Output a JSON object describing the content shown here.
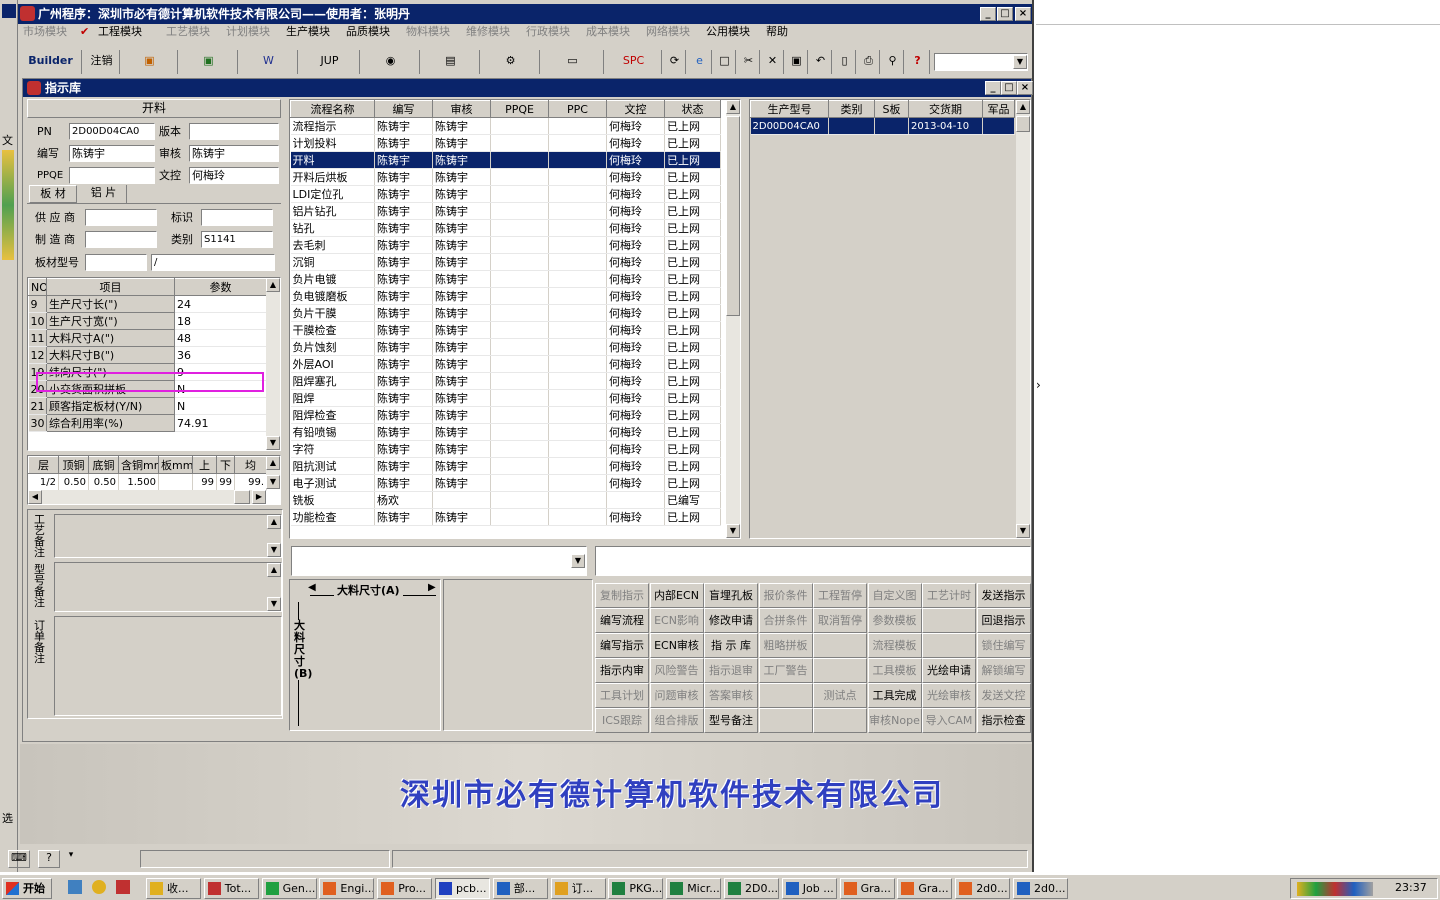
{
  "window_title": "广州程序：深圳市必有德计算机软件技术有限公司——使用者：张明丹",
  "menu": {
    "items": [
      "市场模块",
      "工程模块",
      "工艺模块",
      "计划模块",
      "生产模块",
      "品质模块",
      "物料模块",
      "维修模块",
      "行政模块",
      "成本模块",
      "网络模块",
      "公用模块",
      "帮助"
    ]
  },
  "toolbar": {
    "builder": "Builder",
    "logout": "注销",
    "jup": "JUP",
    "spc": "SPC"
  },
  "child_title": "指示库",
  "left": {
    "section_title": "开料",
    "pn_label": "PN",
    "pn_value": "2D00D04CA0",
    "version_label": "版本",
    "version_value": "",
    "editor_label": "编写",
    "editor_value": "陈铸宇",
    "reviewer_label": "审核",
    "reviewer_value": "陈铸宇",
    "ppqe_label": "PPQE",
    "ppqe_value": "",
    "doc_label": "文控",
    "doc_value": "何梅玲",
    "tab1": "板 材",
    "tab2": "铝 片",
    "supplier_label": "供 应 商",
    "mark_label": "标识",
    "maker_label": "制 造 商",
    "category_label": "类别",
    "category_value": "S1141",
    "board_label": "板材型号",
    "board_value2": "/",
    "params_headers": [
      "NO",
      "项目",
      "参数"
    ],
    "params": [
      {
        "no": "9",
        "item": "生产尺寸长(\")",
        "val": "24"
      },
      {
        "no": "10",
        "item": "生产尺寸宽(\")",
        "val": "18"
      },
      {
        "no": "11",
        "item": "大料尺寸A(\")",
        "val": "48"
      },
      {
        "no": "12",
        "item": "大料尺寸B(\")",
        "val": "36"
      },
      {
        "no": "19",
        "item": "纬向尺寸(\")",
        "val": "9"
      },
      {
        "no": "20",
        "item": "小交货面积拼板",
        "val": "N"
      },
      {
        "no": "21",
        "item": "顾客指定板材(Y/N)",
        "val": "N"
      },
      {
        "no": "30",
        "item": "综合利用率(%)",
        "val": "74.91"
      }
    ],
    "layer_headers": [
      "层",
      "顶铜",
      "底铜",
      "含铜mm",
      "板mm",
      "上",
      "下",
      "均"
    ],
    "layer_row": [
      "1/2",
      "0.50",
      "0.50",
      "1.500",
      "",
      "99",
      "99",
      "99."
    ],
    "note1_label": "工艺备注",
    "note2_label": "型号备注",
    "note3_label": "订单备注"
  },
  "process": {
    "headers": [
      "流程名称",
      "编写",
      "审核",
      "PPQE",
      "PPC",
      "文控",
      "状态"
    ],
    "rows": [
      [
        "流程指示",
        "陈铸宇",
        "陈铸宇",
        "",
        "",
        "何梅玲",
        "已上网"
      ],
      [
        "计划投料",
        "陈铸宇",
        "陈铸宇",
        "",
        "",
        "何梅玲",
        "已上网"
      ],
      [
        "开料",
        "陈铸宇",
        "陈铸宇",
        "",
        "",
        "何梅玲",
        "已上网"
      ],
      [
        "开料后烘板",
        "陈铸宇",
        "陈铸宇",
        "",
        "",
        "何梅玲",
        "已上网"
      ],
      [
        "LDI定位孔",
        "陈铸宇",
        "陈铸宇",
        "",
        "",
        "何梅玲",
        "已上网"
      ],
      [
        "铝片钻孔",
        "陈铸宇",
        "陈铸宇",
        "",
        "",
        "何梅玲",
        "已上网"
      ],
      [
        "钻孔",
        "陈铸宇",
        "陈铸宇",
        "",
        "",
        "何梅玲",
        "已上网"
      ],
      [
        "去毛刺",
        "陈铸宇",
        "陈铸宇",
        "",
        "",
        "何梅玲",
        "已上网"
      ],
      [
        "沉铜",
        "陈铸宇",
        "陈铸宇",
        "",
        "",
        "何梅玲",
        "已上网"
      ],
      [
        "负片电镀",
        "陈铸宇",
        "陈铸宇",
        "",
        "",
        "何梅玲",
        "已上网"
      ],
      [
        "负电镀磨板",
        "陈铸宇",
        "陈铸宇",
        "",
        "",
        "何梅玲",
        "已上网"
      ],
      [
        "负片干膜",
        "陈铸宇",
        "陈铸宇",
        "",
        "",
        "何梅玲",
        "已上网"
      ],
      [
        "干膜检查",
        "陈铸宇",
        "陈铸宇",
        "",
        "",
        "何梅玲",
        "已上网"
      ],
      [
        "负片蚀刻",
        "陈铸宇",
        "陈铸宇",
        "",
        "",
        "何梅玲",
        "已上网"
      ],
      [
        "外层AOI",
        "陈铸宇",
        "陈铸宇",
        "",
        "",
        "何梅玲",
        "已上网"
      ],
      [
        "阻焊塞孔",
        "陈铸宇",
        "陈铸宇",
        "",
        "",
        "何梅玲",
        "已上网"
      ],
      [
        "阻焊",
        "陈铸宇",
        "陈铸宇",
        "",
        "",
        "何梅玲",
        "已上网"
      ],
      [
        "阻焊检查",
        "陈铸宇",
        "陈铸宇",
        "",
        "",
        "何梅玲",
        "已上网"
      ],
      [
        "有铅喷锡",
        "陈铸宇",
        "陈铸宇",
        "",
        "",
        "何梅玲",
        "已上网"
      ],
      [
        "字符",
        "陈铸宇",
        "陈铸宇",
        "",
        "",
        "何梅玲",
        "已上网"
      ],
      [
        "阻抗测试",
        "陈铸宇",
        "陈铸宇",
        "",
        "",
        "何梅玲",
        "已上网"
      ],
      [
        "电子测试",
        "陈铸宇",
        "陈铸宇",
        "",
        "",
        "何梅玲",
        "已上网"
      ],
      [
        "铣板",
        "杨欢",
        "",
        "",
        "",
        "",
        "已编写"
      ],
      [
        "功能检查",
        "陈铸宇",
        "陈铸宇",
        "",
        "",
        "何梅玲",
        "已上网"
      ]
    ],
    "selected_index": 2
  },
  "model": {
    "headers": [
      "生产型号",
      "类别",
      "S板",
      "交货期",
      "军品"
    ],
    "rows": [
      [
        "2D00D04CA0",
        "",
        "",
        "2013-04-10",
        ""
      ]
    ]
  },
  "diagram": {
    "size_a": "大料尺寸(A)",
    "size_b": "大料尺寸(B)"
  },
  "buttons": [
    [
      {
        "t": "复制指示",
        "d": true
      },
      {
        "t": "内部ECN",
        "d": false
      },
      {
        "t": "盲埋孔板",
        "d": false
      },
      {
        "t": "报价条件",
        "d": true
      },
      {
        "t": "工程暂停",
        "d": true
      },
      {
        "t": "自定义图",
        "d": true
      },
      {
        "t": "工艺计时",
        "d": true
      },
      {
        "t": "发送指示",
        "d": false
      }
    ],
    [
      {
        "t": "编写流程",
        "d": false
      },
      {
        "t": "ECN影响",
        "d": true
      },
      {
        "t": "修改申请",
        "d": false
      },
      {
        "t": "合拼条件",
        "d": true
      },
      {
        "t": "取消暂停",
        "d": true
      },
      {
        "t": "参数模板",
        "d": true
      },
      {
        "t": "",
        "d": true
      },
      {
        "t": "回退指示",
        "d": false
      }
    ],
    [
      {
        "t": "编写指示",
        "d": false
      },
      {
        "t": "ECN审核",
        "d": false
      },
      {
        "t": "指 示 库",
        "d": false
      },
      {
        "t": "粗略拼板",
        "d": true
      },
      {
        "t": "",
        "d": true
      },
      {
        "t": "流程模板",
        "d": true
      },
      {
        "t": "",
        "d": true
      },
      {
        "t": "锁住编写",
        "d": true
      }
    ],
    [
      {
        "t": "指示内审",
        "d": false
      },
      {
        "t": "风险警告",
        "d": true
      },
      {
        "t": "指示退审",
        "d": true
      },
      {
        "t": "工厂警告",
        "d": true
      },
      {
        "t": "",
        "d": true
      },
      {
        "t": "工具模板",
        "d": true
      },
      {
        "t": "光绘申请",
        "d": false
      },
      {
        "t": "解锁编写",
        "d": true
      }
    ],
    [
      {
        "t": "工具计划",
        "d": true
      },
      {
        "t": "问题审核",
        "d": true
      },
      {
        "t": "答案审核",
        "d": true
      },
      {
        "t": "",
        "d": true
      },
      {
        "t": "测试点",
        "d": true
      },
      {
        "t": "工具完成",
        "d": false
      },
      {
        "t": "光绘审核",
        "d": true
      },
      {
        "t": "发送文控",
        "d": true
      }
    ],
    [
      {
        "t": "ICS跟踪",
        "d": true
      },
      {
        "t": "组合排版",
        "d": true
      },
      {
        "t": "型号备注",
        "d": false
      },
      {
        "t": "",
        "d": true
      },
      {
        "t": "",
        "d": true
      },
      {
        "t": "审核Nope",
        "d": true
      },
      {
        "t": "导入CAM",
        "d": true
      },
      {
        "t": "指示检查",
        "d": false
      }
    ]
  ],
  "banner": "深圳市必有德计算机软件技术有限公司",
  "taskbar": {
    "start": "开始",
    "tasks": [
      "收...",
      "Tot...",
      "Gen...",
      "Engi...",
      "Pro...",
      "pcb...",
      "部...",
      "订...",
      "PKG...",
      "Micr...",
      "2D0...",
      "Job ...",
      "Gra...",
      "Gra...",
      "2d0...",
      "2d0..."
    ],
    "clock": "23:37"
  },
  "left_strip": [
    "文",
    "选"
  ]
}
